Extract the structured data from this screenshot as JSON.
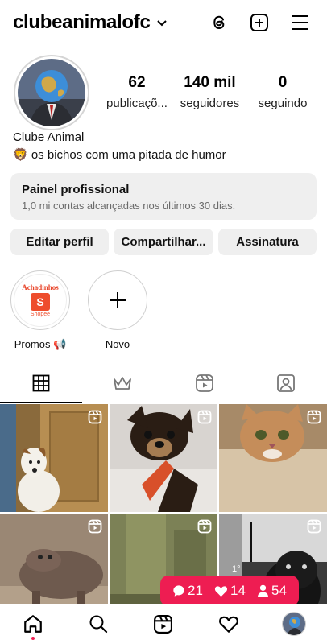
{
  "header": {
    "username": "clubeanimalofc"
  },
  "profile": {
    "stats": [
      {
        "num": "62",
        "label": "publicaçõ..."
      },
      {
        "num": "140 mil",
        "label": "seguidores"
      },
      {
        "num": "0",
        "label": "seguindo"
      }
    ],
    "display_name": "Clube Animal",
    "bio": "🦁 os bichos com uma pitada de humor"
  },
  "dashboard": {
    "title": "Painel profissional",
    "subtitle": "1,0 mi contas alcançadas nos últimos 30 dias."
  },
  "actions": {
    "edit": "Editar perfil",
    "share": "Compartilhar...",
    "subscription": "Assinatura"
  },
  "highlights": [
    {
      "label": "Promos 📢",
      "logo_top": "Achadinhos",
      "logo_bottom": "Shopee"
    },
    {
      "label": "Novo"
    }
  ],
  "tabs": [
    "grid-icon",
    "crown-icon",
    "reels-icon",
    "tagged-icon"
  ],
  "notifications": {
    "comments": "21",
    "likes": "14",
    "followers": "54"
  },
  "colors": {
    "accent": "#ee1d52",
    "button_bg": "#efefef"
  }
}
